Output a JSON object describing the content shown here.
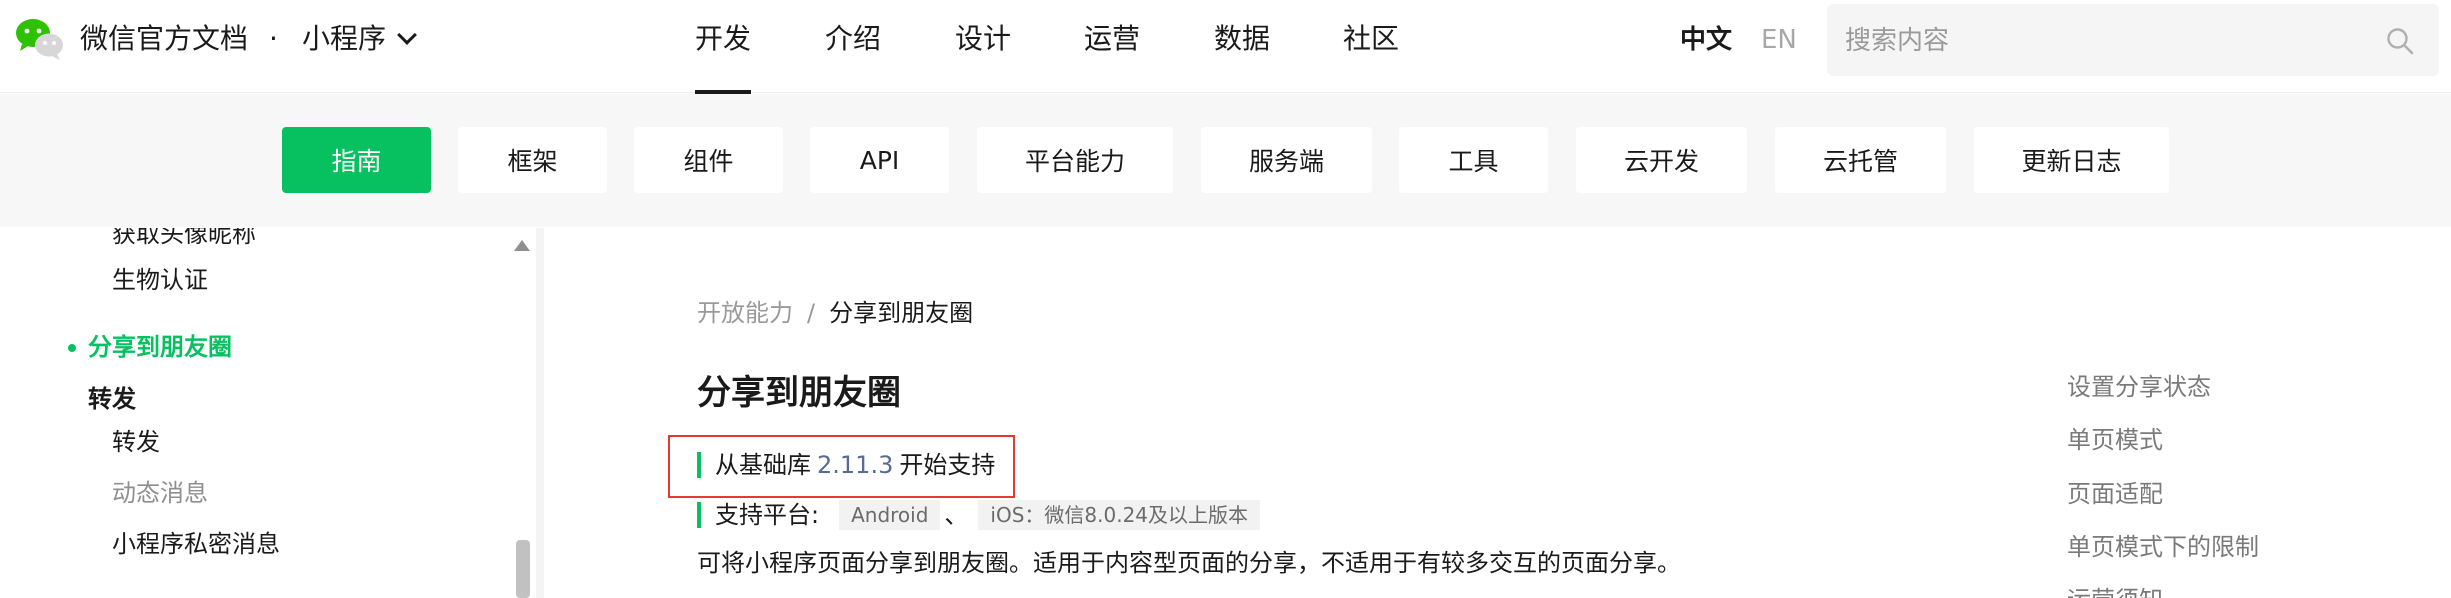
{
  "header": {
    "site_title": "微信官方文档",
    "dot": "·",
    "product": "小程序",
    "nav": [
      {
        "label": "开发",
        "active": true
      },
      {
        "label": "介绍",
        "active": false
      },
      {
        "label": "设计",
        "active": false
      },
      {
        "label": "运营",
        "active": false
      },
      {
        "label": "数据",
        "active": false
      },
      {
        "label": "社区",
        "active": false
      }
    ],
    "lang_zh": "中文",
    "lang_en": "EN",
    "search_placeholder": "搜索内容"
  },
  "sub_nav": [
    {
      "label": "指南",
      "active": true
    },
    {
      "label": "框架",
      "active": false
    },
    {
      "label": "组件",
      "active": false
    },
    {
      "label": "API",
      "active": false
    },
    {
      "label": "平台能力",
      "active": false
    },
    {
      "label": "服务端",
      "active": false
    },
    {
      "label": "工具",
      "active": false
    },
    {
      "label": "云开发",
      "active": false
    },
    {
      "label": "云托管",
      "active": false
    },
    {
      "label": "更新日志",
      "active": false
    }
  ],
  "sidebar": {
    "items": [
      {
        "label": "获取头像昵称"
      },
      {
        "label": "生物认证"
      },
      {
        "label": "分享到朋友圈"
      },
      {
        "label": "转发"
      },
      {
        "label": "转发"
      },
      {
        "label": "动态消息"
      },
      {
        "label": "小程序私密消息"
      }
    ]
  },
  "content": {
    "breadcrumb_parent": "开放能力",
    "breadcrumb_sep": "/",
    "breadcrumb_current": "分享到朋友圈",
    "title": "分享到朋友圈",
    "support_prefix": "从基础库",
    "support_version": "2.11.3",
    "support_suffix": "开始支持",
    "platform_label": "支持平台:",
    "platform_android": "Android",
    "platform_sep": "、",
    "platform_ios": "iOS：微信8.0.24及以上版本",
    "description": "可将小程序页面分享到朋友圈。适用于内容型页面的分享，不适用于有较多交互的页面分享。"
  },
  "toc": {
    "items": [
      {
        "label": "设置分享状态"
      },
      {
        "label": "单页模式"
      },
      {
        "label": "页面适配"
      },
      {
        "label": "单页模式下的限制"
      },
      {
        "label": "运营须知"
      }
    ]
  },
  "colors": {
    "accent": "#07c160",
    "link": "#576b95",
    "highlight_border": "#e53935"
  }
}
